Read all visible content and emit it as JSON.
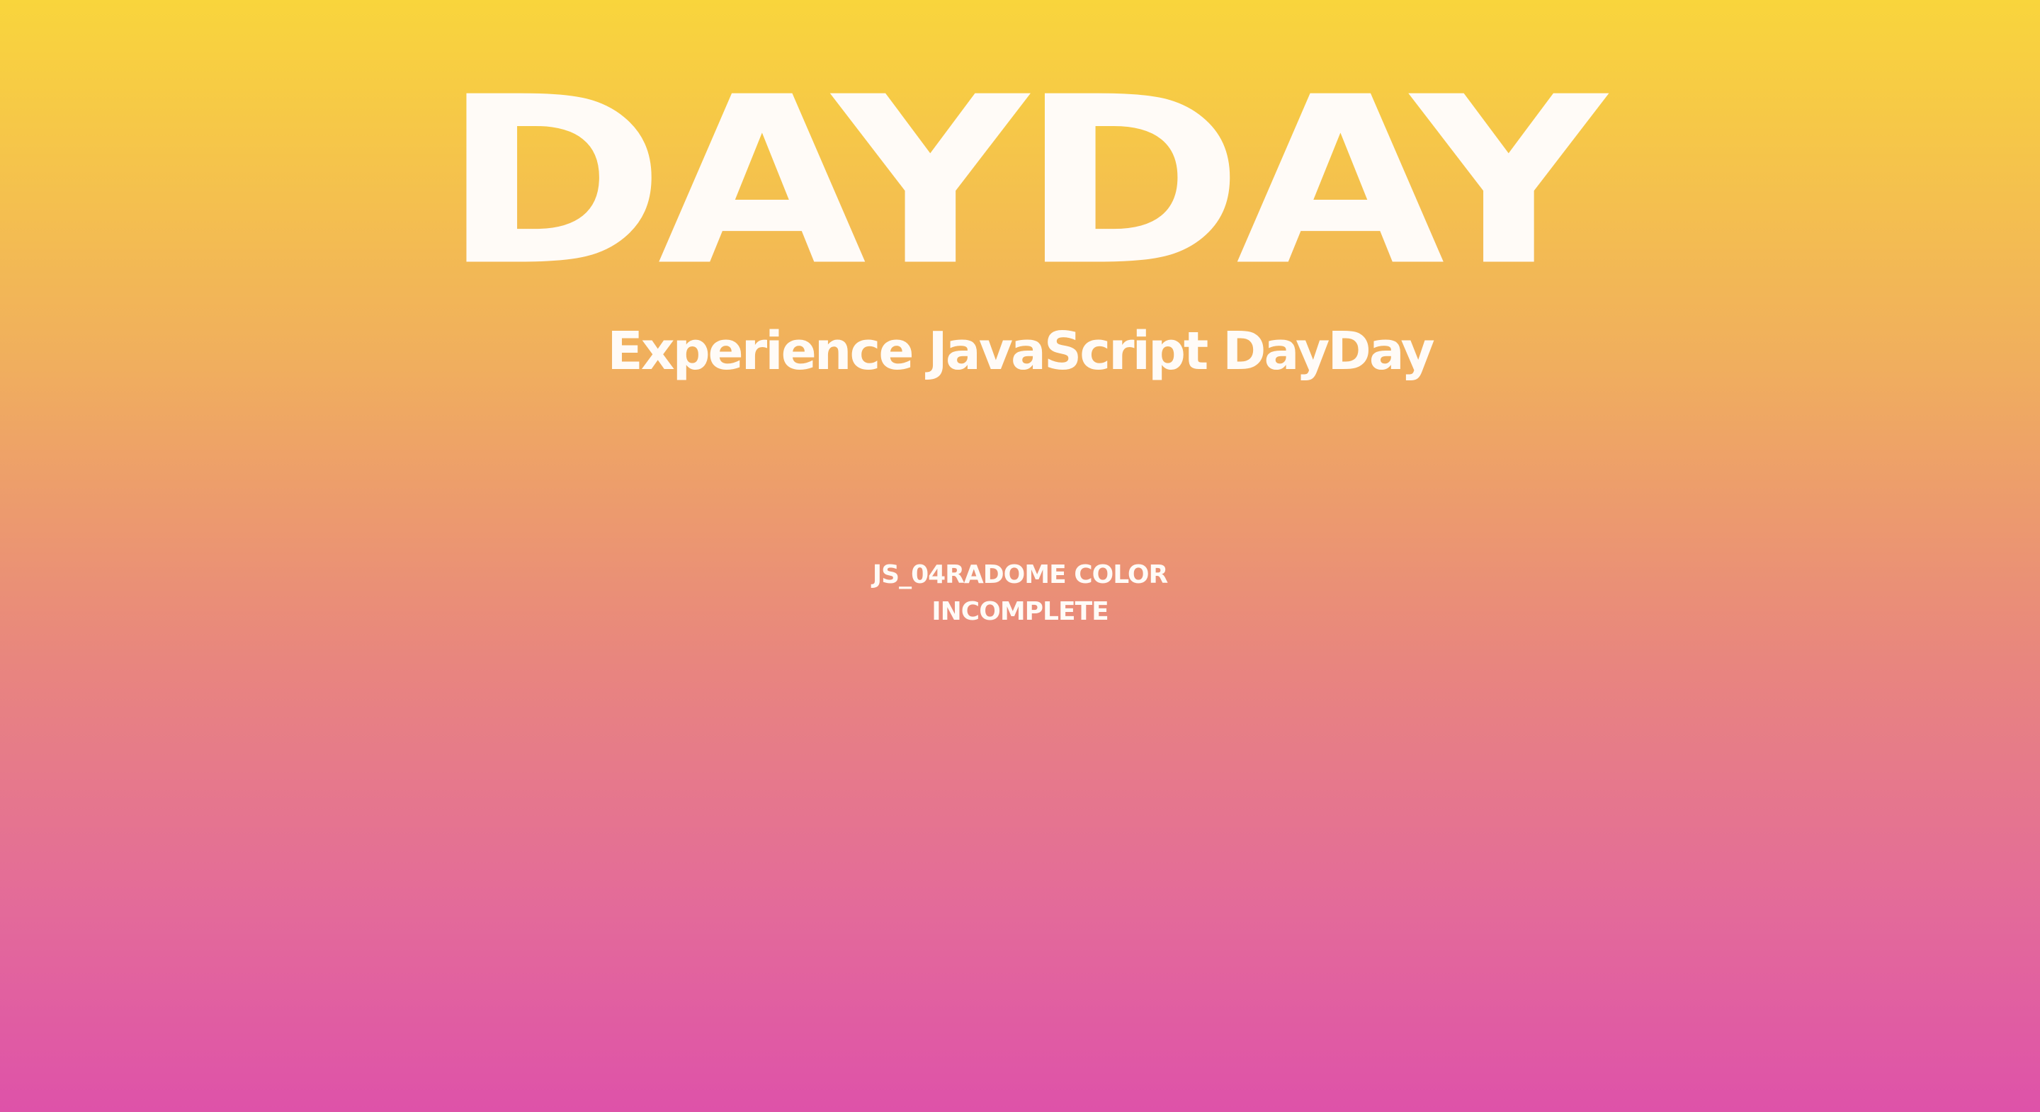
{
  "hero": {
    "title": "DAYDAY"
  },
  "subtitle": {
    "text": "Experience JavaScript DayDay"
  },
  "status": {
    "line1": "JS_04RADOME COLOR",
    "line2": "INCOMPLETE"
  },
  "colors": {
    "text": "#FFFBF7",
    "gradient_top": "#F9D53C",
    "gradient_bottom": "#DE52A9"
  }
}
